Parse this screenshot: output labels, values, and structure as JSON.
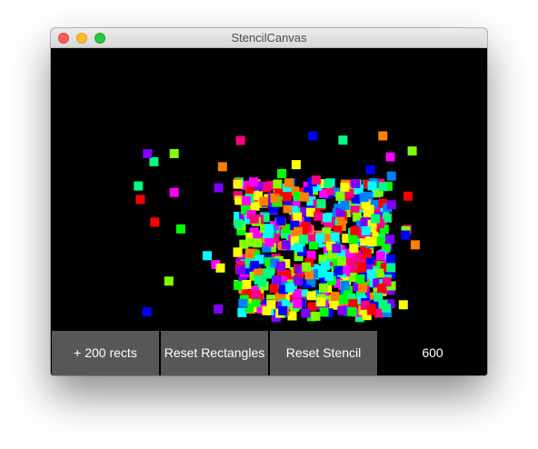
{
  "window": {
    "title": "StencilCanvas"
  },
  "controls": {
    "add_rects_label": "+ 200 rects",
    "reset_rectangles_label": "Reset Rectangles",
    "reset_stencil_label": "Reset Stencil",
    "rect_count": "600"
  },
  "canvas": {
    "background": "#000000",
    "palette": [
      "#ff0000",
      "#ff8000",
      "#ffff00",
      "#80ff00",
      "#00ff00",
      "#00ff80",
      "#00ffff",
      "#0080ff",
      "#0000ff",
      "#8000ff",
      "#ff00ff",
      "#ff0080"
    ]
  }
}
